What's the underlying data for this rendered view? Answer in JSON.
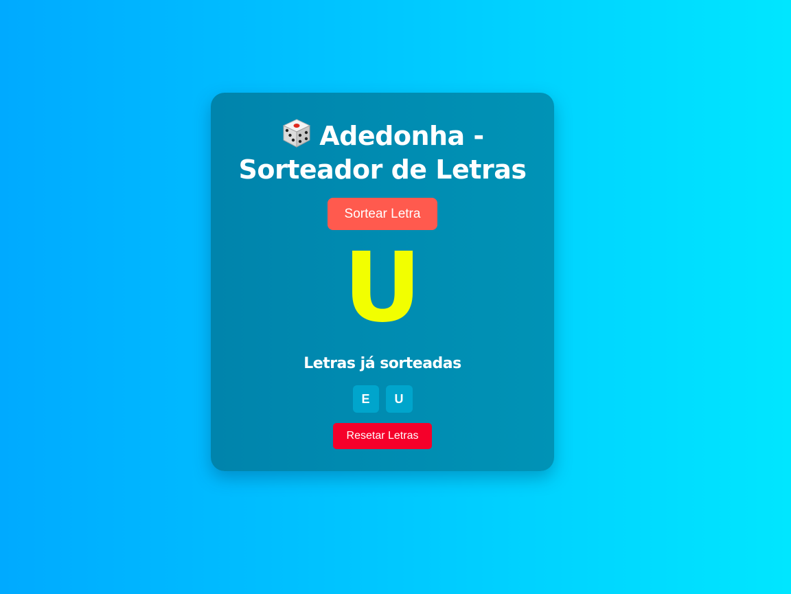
{
  "app": {
    "title_line1": "Adedonha -",
    "title_line2": "Sorteador de Letras",
    "icon": "dice-icon"
  },
  "draw_button": {
    "label": "Sortear Letra"
  },
  "current_letter": "U",
  "drawn": {
    "title": "Letras já sorteadas",
    "letters": [
      "E",
      "U"
    ]
  },
  "reset_button": {
    "label": "Resetar Letras"
  },
  "colors": {
    "background_start": "#00aaff",
    "background_end": "#00e6ff",
    "card": "#0088b0",
    "draw_button": "#ff5a4e",
    "current_letter": "#f2ff00",
    "drawn_chip": "#00a5cc",
    "reset_button": "#f5002a"
  }
}
